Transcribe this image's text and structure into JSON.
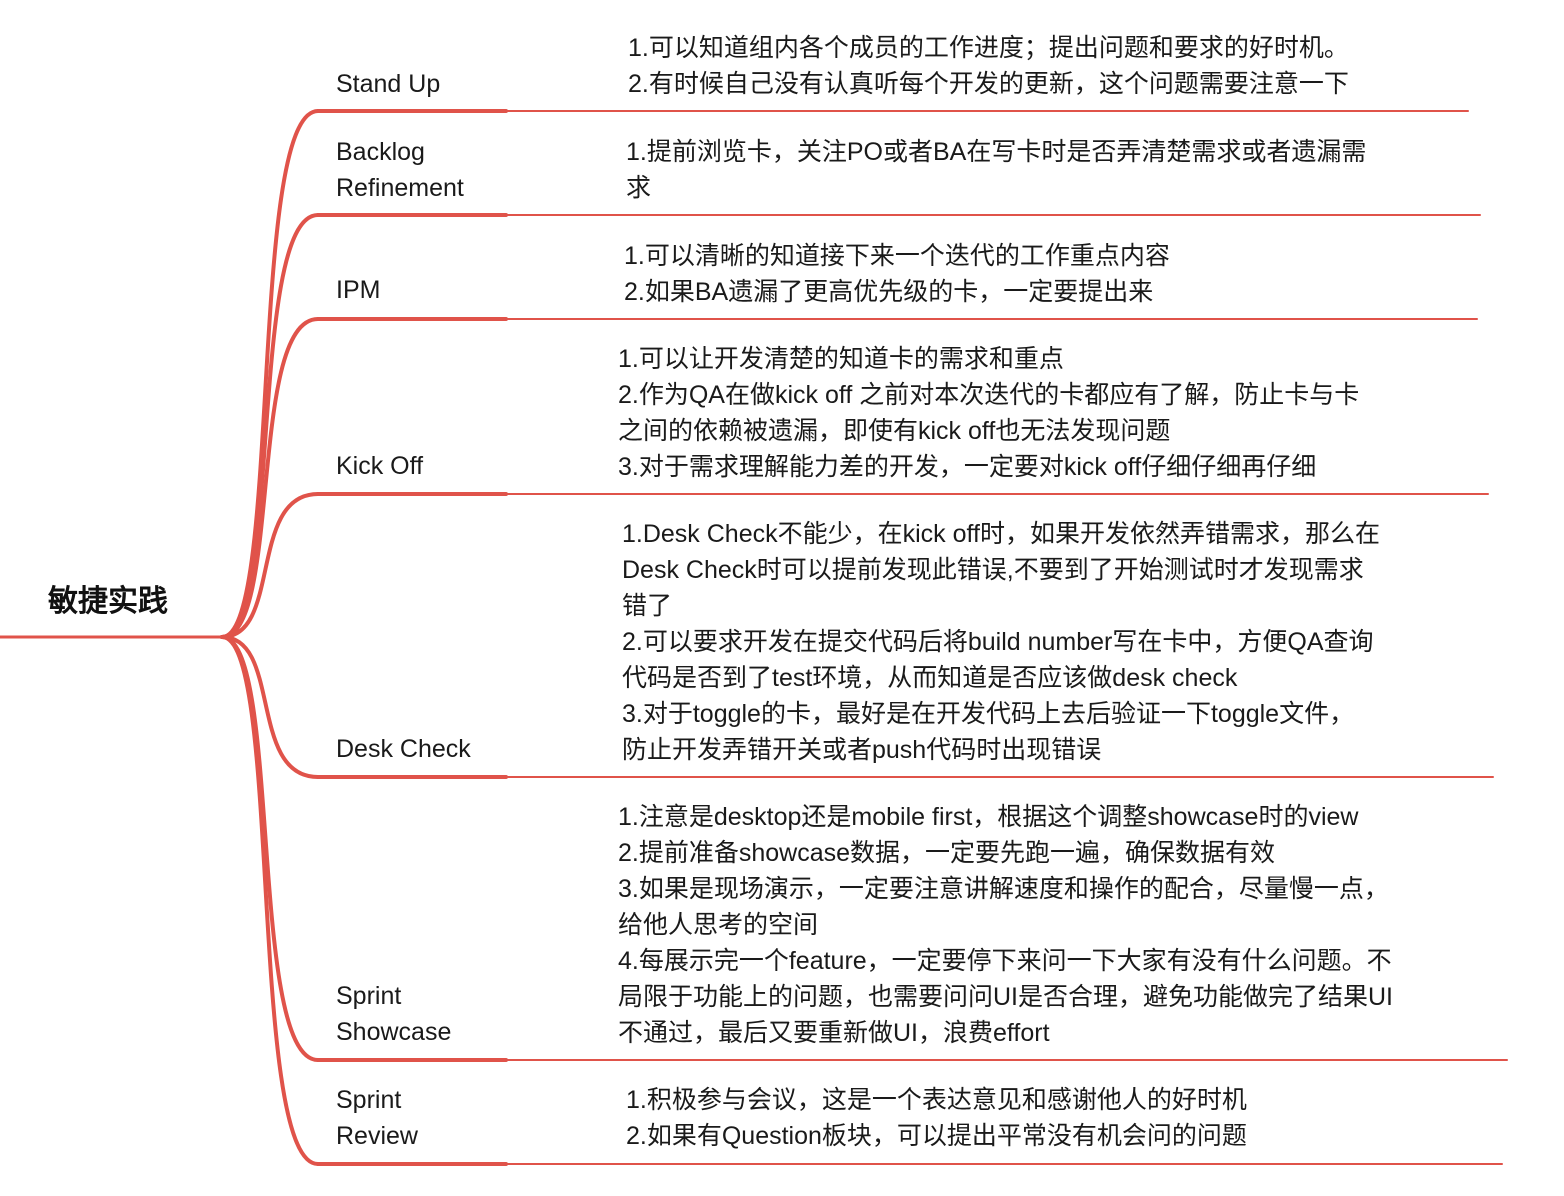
{
  "root": {
    "label": "敏捷实践"
  },
  "colors": {
    "branch_line": "#e0534a",
    "text": "#1a1a1a",
    "background": "#ffffff"
  },
  "branches": [
    {
      "id": "stand-up",
      "label_lines": [
        "Stand Up"
      ],
      "detail_lines": [
        "1.可以知道组内各个成员的工作进度；提出问题和要求的好时机。",
        "2.有时候自己没有认真听每个开发的更新，这个问题需要注意一下"
      ]
    },
    {
      "id": "backlog-refinement",
      "label_lines": [
        "Backlog",
        "Refinement"
      ],
      "detail_lines": [
        "1.提前浏览卡，关注PO或者BA在写卡时是否弄清楚需求或者遗漏需",
        "求"
      ]
    },
    {
      "id": "ipm",
      "label_lines": [
        "IPM"
      ],
      "detail_lines": [
        "1.可以清晰的知道接下来一个迭代的工作重点内容",
        "2.如果BA遗漏了更高优先级的卡，一定要提出来"
      ]
    },
    {
      "id": "kick-off",
      "label_lines": [
        "Kick Off"
      ],
      "detail_lines": [
        "1.可以让开发清楚的知道卡的需求和重点",
        "2.作为QA在做kick off 之前对本次迭代的卡都应有了解，防止卡与卡",
        "之间的依赖被遗漏，即使有kick off也无法发现问题",
        "3.对于需求理解能力差的开发，一定要对kick off仔细仔细再仔细"
      ]
    },
    {
      "id": "desk-check",
      "label_lines": [
        "Desk Check"
      ],
      "detail_lines": [
        "1.Desk Check不能少，在kick off时，如果开发依然弄错需求，那么在",
        "Desk Check时可以提前发现此错误,不要到了开始测试时才发现需求",
        "错了",
        "2.可以要求开发在提交代码后将build number写在卡中，方便QA查询",
        "代码是否到了test环境，从而知道是否应该做desk check",
        "3.对于toggle的卡，最好是在开发代码上去后验证一下toggle文件，",
        "防止开发弄错开关或者push代码时出现错误"
      ]
    },
    {
      "id": "sprint-showcase",
      "label_lines": [
        "Sprint",
        "Showcase"
      ],
      "detail_lines": [
        "1.注意是desktop还是mobile first，根据这个调整showcase时的view",
        "2.提前准备showcase数据，一定要先跑一遍，确保数据有效",
        "3.如果是现场演示，一定要注意讲解速度和操作的配合，尽量慢一点，",
        "给他人思考的空间",
        "4.每展示完一个feature，一定要停下来问一下大家有没有什么问题。不",
        "局限于功能上的问题，也需要问问UI是否合理，避免功能做完了结果UI",
        "不通过，最后又要重新做UI，浪费effort"
      ]
    },
    {
      "id": "sprint-review",
      "label_lines": [
        "Sprint",
        "Review"
      ],
      "detail_lines": [
        "1.积极参与会议，这是一个表达意见和感谢他人的好时机",
        "2.如果有Question板块，可以提出平常没有机会问的问题"
      ]
    }
  ]
}
